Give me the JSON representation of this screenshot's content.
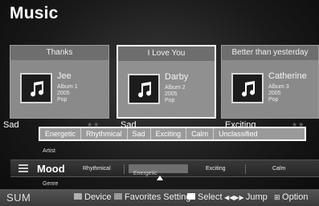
{
  "title": "Music",
  "cards": [
    {
      "song": "Thanks",
      "artist": "Jee",
      "album": "Album 1",
      "year": "2005",
      "genre": "Pop",
      "mood": "Sad"
    },
    {
      "song": "I Love You",
      "artist": "Darby",
      "album": "Album 2",
      "year": "2005",
      "genre": "Pop",
      "mood": "Sad"
    },
    {
      "song": "Better than yesterday",
      "artist": "Catherine",
      "album": "Album 3",
      "year": "2005",
      "genre": "Pop",
      "mood": "Exciting"
    }
  ],
  "mood_popup": {
    "options": [
      "Energetic",
      "Rhythmical",
      "Sad",
      "Exciting",
      "Calm",
      "Unclassified"
    ]
  },
  "categories": {
    "above": "Artist",
    "current": "Mood",
    "below": "Genre",
    "items": [
      "Rhythmical",
      "Energetic",
      "Exciting",
      "Calm"
    ]
  },
  "footer": {
    "sum": "SUM",
    "device": "Device",
    "favorites": "Favorites Setting",
    "select": "Select",
    "jump": "Jump",
    "option": "Option",
    "colors": {
      "device": "#b0b0b0",
      "favorites": "#9a9a9a",
      "select": "#ffffff"
    }
  }
}
